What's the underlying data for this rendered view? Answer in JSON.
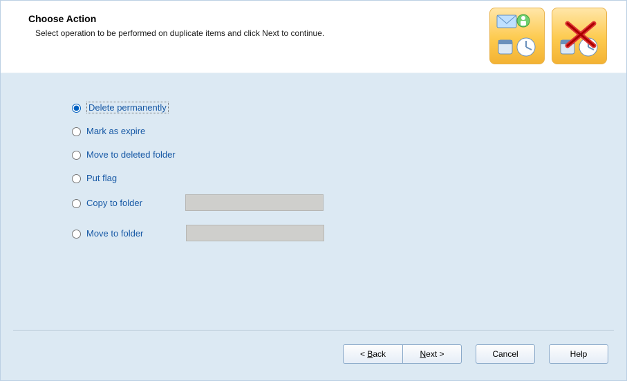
{
  "header": {
    "title": "Choose Action",
    "subtitle": "Select operation to be performed on duplicate items and click Next to continue."
  },
  "options": {
    "delete_permanently": "Delete permanently",
    "mark_expire": "Mark as expire",
    "move_deleted": "Move to deleted folder",
    "put_flag": "Put flag",
    "copy_to_folder": "Copy to folder",
    "move_to_folder": "Move to folder",
    "selected": "delete_permanently",
    "copy_folder_value": "",
    "move_folder_value": ""
  },
  "buttons": {
    "back": "< Back",
    "next": "Next >",
    "cancel": "Cancel",
    "help": "Help"
  }
}
